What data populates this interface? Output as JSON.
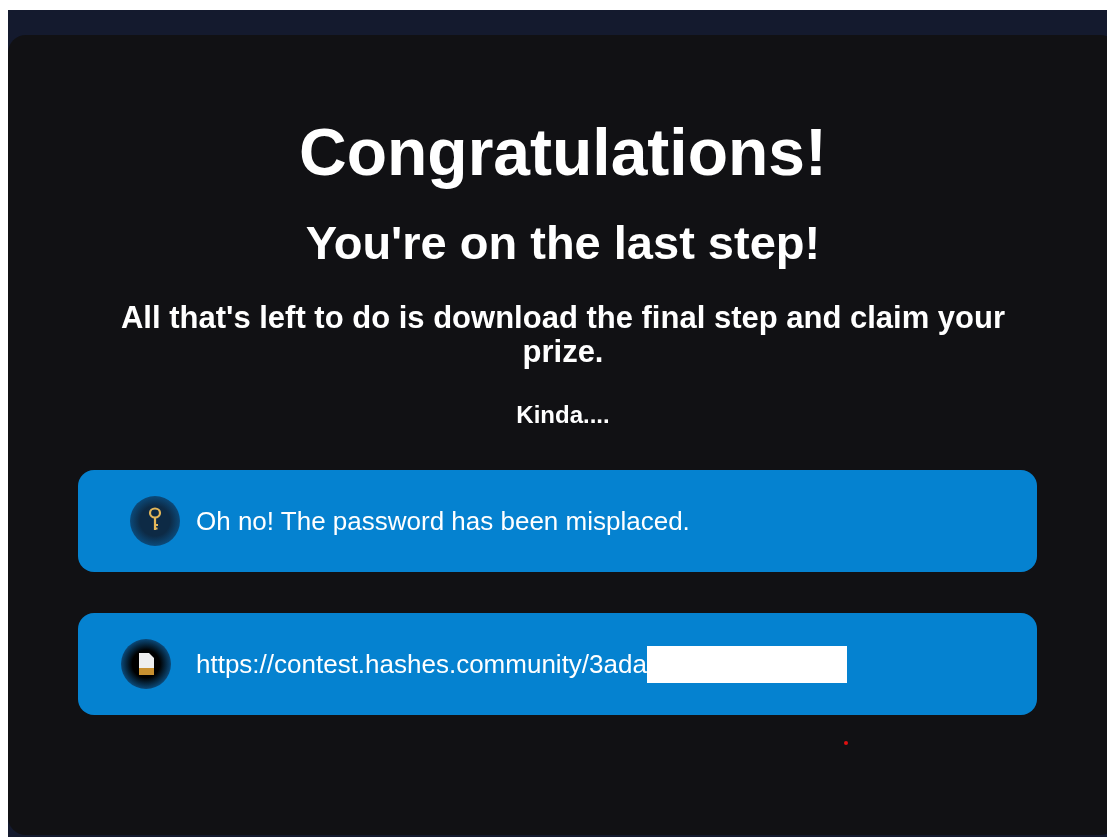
{
  "heading": "Congratulations!",
  "subheading": "You're on the last step!",
  "message": "All that's left to do is download the final step and claim your prize.",
  "note": "Kinda....",
  "items": [
    {
      "kind": "key",
      "text": "Oh no! The password has been misplaced.",
      "redacted": false
    },
    {
      "kind": "file",
      "text": "https://contest.hashes.community/3ada",
      "redacted": true
    }
  ]
}
